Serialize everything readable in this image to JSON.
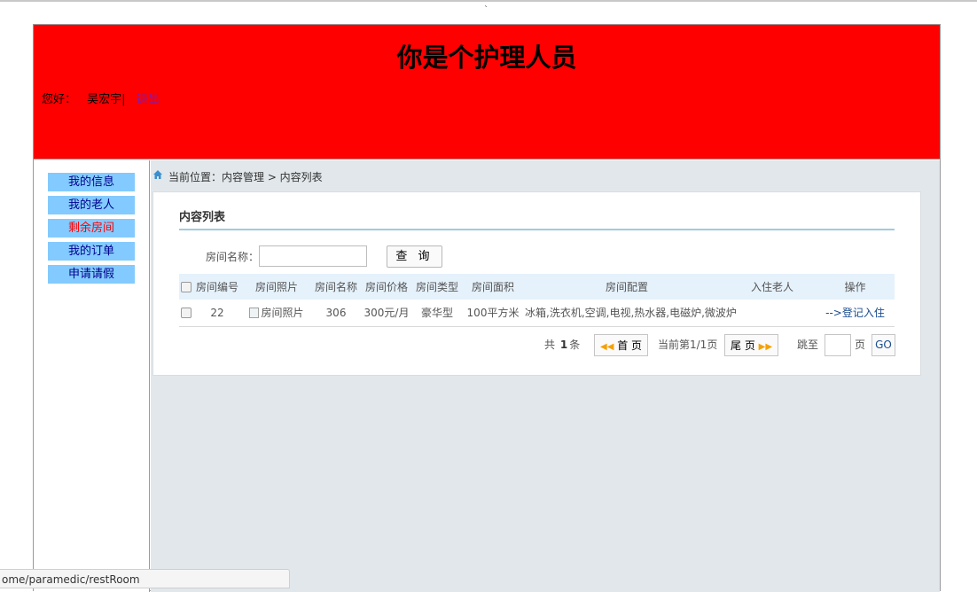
{
  "header": {
    "title": "你是个护理人员",
    "greeting_label": "您好：",
    "user_name": "吴宏宇|",
    "logout": "退出",
    "bg_color": "#ff0000"
  },
  "sidebar": {
    "items": [
      {
        "label": "我的信息",
        "active": false
      },
      {
        "label": "我的老人",
        "active": false
      },
      {
        "label": "剩余房间",
        "active": true
      },
      {
        "label": "我的订单",
        "active": false
      },
      {
        "label": "申请请假",
        "active": false
      }
    ]
  },
  "breadcrumb": {
    "text": "当前位置：内容管理 > 内容列表",
    "icon": "home-icon"
  },
  "panel": {
    "title": "内容列表",
    "search_label": "房间名称：",
    "search_value": "",
    "search_button": "查 询"
  },
  "table": {
    "headers": [
      "房间编号",
      "房间照片",
      "房间名称",
      "房间价格",
      "房间类型",
      "房间面积",
      "房间配置",
      "入住老人",
      "操作"
    ],
    "rows": [
      {
        "id": "22",
        "photo_alt": "房间照片",
        "name": "306",
        "price": "300元/月",
        "type": "豪华型",
        "area": "100平方米",
        "config": "冰箱,洗衣机,空调,电视,热水器,电磁炉,微波炉",
        "elder": "",
        "action": "-->登记入住"
      }
    ]
  },
  "pager": {
    "total_prefix": "共",
    "total": "1",
    "total_suffix": "条",
    "first": "首 页",
    "current": "当前第1/1页",
    "last": "尾 页",
    "jump_label": "跳至",
    "page_unit": "页",
    "go": "GO"
  },
  "status_bar": {
    "url": "ome/paramedic/restRoom"
  },
  "misc": {
    "tick": "`"
  }
}
